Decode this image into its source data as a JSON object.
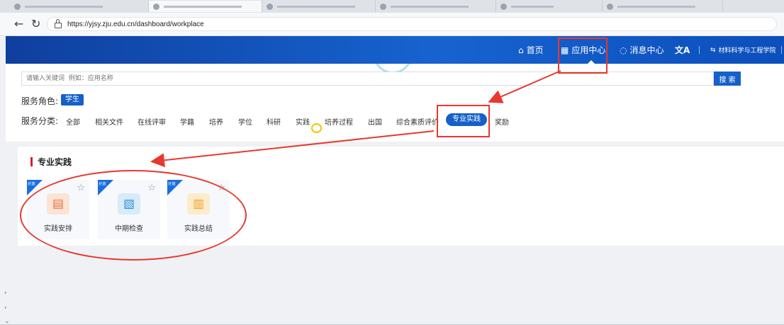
{
  "browser": {
    "url": "https://yjsy.zju.edu.cn/dashboard/workplace"
  },
  "header": {
    "nav": [
      {
        "label": "首页",
        "icon": "home-icon"
      },
      {
        "label": "应用中心",
        "icon": "grid-icon"
      },
      {
        "label": "消息中心",
        "icon": "message-icon"
      }
    ],
    "translate_icon": "translate-icon",
    "college": "材料科学与工程学院"
  },
  "search": {
    "placeholder": "请输入关键词  例如：应用名称",
    "button": "搜 索"
  },
  "role": {
    "label": "服务角色:",
    "value": "学生"
  },
  "categories": {
    "label": "服务分类:",
    "items": [
      "全部",
      "相关文件",
      "在线评审",
      "学籍",
      "培养",
      "学位",
      "科研",
      "实践",
      "培养过程",
      "出国",
      "综合素质评价",
      "专业实践",
      "奖励"
    ],
    "active": "专业实践"
  },
  "section": {
    "title": "专业实践",
    "apps": [
      {
        "name": "实践安排",
        "badge": "开放",
        "icon": "schedule-icon",
        "color": "#e8713a"
      },
      {
        "name": "中期检查",
        "badge": "开放",
        "icon": "inspect-icon",
        "color": "#2f8fd6"
      },
      {
        "name": "实践总结",
        "badge": "开放",
        "icon": "summary-icon",
        "color": "#f0a020"
      }
    ]
  },
  "colors": {
    "primary": "#1560c9",
    "header_start": "#0f3f9e",
    "annotation": "#e8382e"
  }
}
